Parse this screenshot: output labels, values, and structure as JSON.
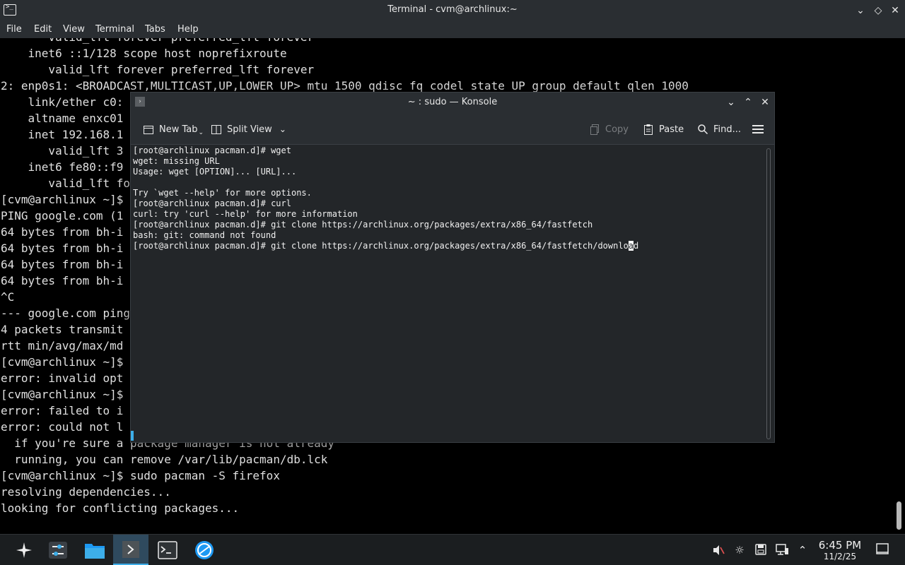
{
  "bg_window": {
    "title": "Terminal - cvm@archlinux:~",
    "menu": [
      "File",
      "Edit",
      "View",
      "Terminal",
      "Tabs",
      "Help"
    ],
    "lines": [
      "       valid_lft forever preferred_lft forever",
      "    inet6 ::1/128 scope host noprefixroute",
      "       valid_lft forever preferred_lft forever",
      "2: enp0s1: <BROADCAST,MULTICAST,UP,LOWER_UP> mtu 1500 qdisc fq_codel state UP group default qlen 1000",
      "    link/ether c0:",
      "    altname enxc01",
      "    inet 192.168.1",
      "       valid_lft 3",
      "    inet6 fe80::f9",
      "       valid_lft fo",
      "[cvm@archlinux ~]$",
      "PING google.com (1",
      "64 bytes from bh-i",
      "64 bytes from bh-i",
      "64 bytes from bh-i",
      "64 bytes from bh-i",
      "^C",
      "--- google.com ping",
      "4 packets transmit",
      "rtt min/avg/max/md",
      "[cvm@archlinux ~]$",
      "error: invalid opt",
      "[cvm@archlinux ~]$",
      "error: failed to i",
      "error: could not l",
      "  if you're sure a package manager is not already",
      "  running, you can remove /var/lib/pacman/db.lck",
      "[cvm@archlinux ~]$ sudo pacman -S firefox",
      "resolving dependencies...",
      "looking for conflicting packages..."
    ]
  },
  "konsole": {
    "title": "~ : sudo — Konsole",
    "toolbar": {
      "new_tab": "New Tab",
      "split_view": "Split View",
      "copy": "Copy",
      "paste": "Paste",
      "find": "Find..."
    },
    "lines": [
      "[root@archlinux pacman.d]# wget",
      "wget: missing URL",
      "Usage: wget [OPTION]... [URL]...",
      "",
      "Try `wget --help' for more options.",
      "[root@archlinux pacman.d]# curl",
      "curl: try 'curl --help' for more information",
      "[root@archlinux pacman.d]# git clone https://archlinux.org/packages/extra/x86_64/fastfetch",
      "bash: git: command not found"
    ],
    "current_line_before_cursor": "[root@archlinux pacman.d]# git clone https://archlinux.org/packages/extra/x86_64/fastfetch/downlo",
    "cursor_char": "a",
    "current_line_after_cursor": "d"
  },
  "taskbar": {
    "time": "6:45 PM",
    "date": "11/2/25",
    "icons": [
      "app-launcher-icon",
      "system-settings-icon",
      "file-manager-icon",
      "konsole-icon",
      "terminal-icon",
      "browser-icon"
    ]
  },
  "colors": {
    "accent": "#3daee9",
    "titlebar": "#2a2e32",
    "konsole_bg": "#232629"
  }
}
